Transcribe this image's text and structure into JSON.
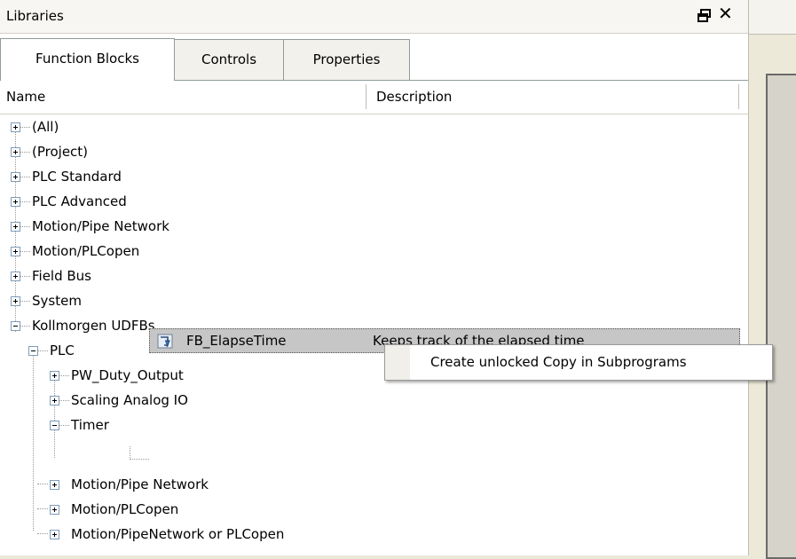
{
  "panel": {
    "title": "Libraries"
  },
  "tabs": [
    {
      "label": "Function Blocks",
      "active": true
    },
    {
      "label": "Controls",
      "active": false
    },
    {
      "label": "Properties",
      "active": false
    }
  ],
  "columns": {
    "name": "Name",
    "description": "Description"
  },
  "tree": {
    "all": "(All)",
    "project": "(Project)",
    "plc_standard": "PLC Standard",
    "plc_advanced": "PLC Advanced",
    "motion_pipe_network": "Motion/Pipe Network",
    "motion_plcopen": "Motion/PLCopen",
    "field_bus": "Field Bus",
    "system": "System",
    "kollmorgen": "Kollmorgen UDFBs",
    "plc": "PLC",
    "pw_duty_output": "PW_Duty_Output",
    "scaling_analog_io": "Scaling Analog IO",
    "timer": "Timer",
    "fb_elapsetime": "FB_ElapseTime",
    "fb_elapsetime_desc": "Keeps track of the elapsed time",
    "sub_motion_pipe_network": "Motion/Pipe Network",
    "sub_motion_plcopen": "Motion/PLCopen",
    "sub_motion_pipenetwork_or_plcopen": "Motion/PipeNetwork or PLCopen"
  },
  "context_menu": {
    "items": [
      "Create unlocked Copy in Subprograms"
    ]
  },
  "icons": {
    "pin": "restore-icon",
    "close": "close-icon",
    "block": "function-block-icon"
  },
  "colors": {
    "selection": "#c6c6c6",
    "tab_border": "#919b9c",
    "background": "#ece9d8"
  }
}
